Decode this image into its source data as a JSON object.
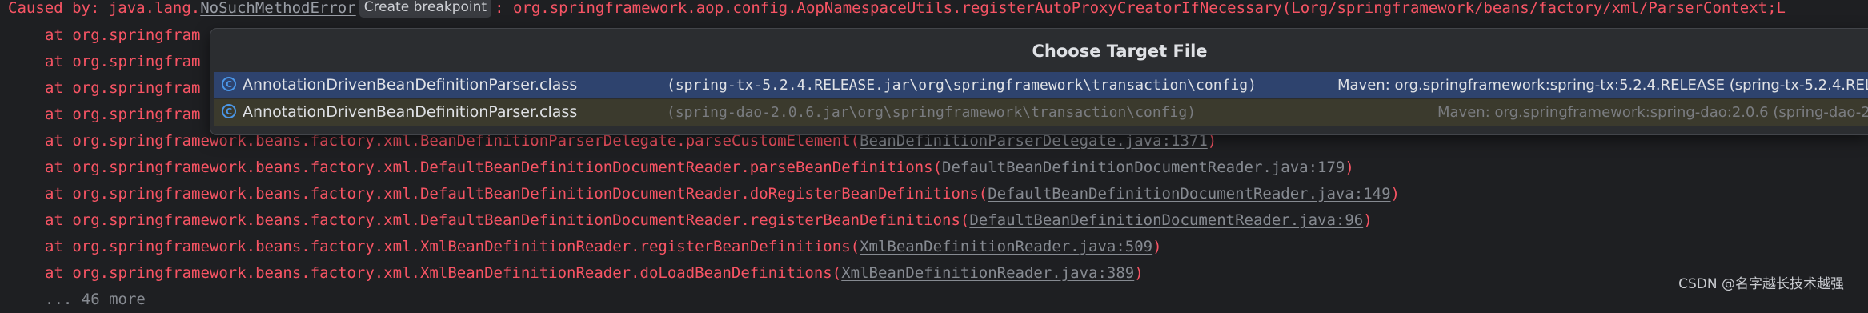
{
  "console": {
    "caused_by_prefix": "Caused by: java.lang.",
    "exception_name": "NoSuchMethodError",
    "breakpoint_button": "Create breakpoint",
    "caused_by_rest": ": org.springframework.aop.config.AopNamespaceUtils.registerAutoProxyCreatorIfNecessary(Lorg/springframework/beans/factory/xml/ParserContext;L",
    "lines": [
      {
        "prefix": "at org.springfram",
        "link": "",
        "suffix": ""
      },
      {
        "prefix": "at org.springfram",
        "link": "",
        "suffix": ""
      },
      {
        "prefix": "at org.springfram",
        "link": "",
        "suffix": ""
      },
      {
        "prefix": "at org.springfram",
        "link": "",
        "suffix": ""
      },
      {
        "prefix": "at org.springframework.beans.factory.xml.BeanDefinitionParserDelegate.parseCustomElement(",
        "link": "BeanDefinitionParserDelegate.java:1371",
        "suffix": ")"
      },
      {
        "prefix": "at org.springframework.beans.factory.xml.DefaultBeanDefinitionDocumentReader.parseBeanDefinitions(",
        "link": "DefaultBeanDefinitionDocumentReader.java:179",
        "suffix": ")"
      },
      {
        "prefix": "at org.springframework.beans.factory.xml.DefaultBeanDefinitionDocumentReader.doRegisterBeanDefinitions(",
        "link": "DefaultBeanDefinitionDocumentReader.java:149",
        "suffix": ")"
      },
      {
        "prefix": "at org.springframework.beans.factory.xml.DefaultBeanDefinitionDocumentReader.registerBeanDefinitions(",
        "link": "DefaultBeanDefinitionDocumentReader.java:96",
        "suffix": ")"
      },
      {
        "prefix": "at org.springframework.beans.factory.xml.XmlBeanDefinitionReader.registerBeanDefinitions(",
        "link": "XmlBeanDefinitionReader.java:509",
        "suffix": ")"
      },
      {
        "prefix": "at org.springframework.beans.factory.xml.XmlBeanDefinitionReader.doLoadBeanDefinitions(",
        "link": "XmlBeanDefinitionReader.java:389",
        "suffix": ")"
      }
    ],
    "last_partial": "... 46 more"
  },
  "popup": {
    "title": "Choose Target File",
    "icon_letter": "C",
    "icon": "class-icon",
    "items": [
      {
        "class_name": "AnnotationDrivenBeanDefinitionParser.class",
        "path": "(spring-tx-5.2.4.RELEASE.jar\\org\\springframework\\transaction\\config)",
        "maven": "Maven: org.springframework:spring-tx:5.2.4.RELEASE (spring-tx-5.2.4.RELE",
        "selected": true
      },
      {
        "class_name": "AnnotationDrivenBeanDefinitionParser.class",
        "path": "(spring-dao-2.0.6.jar\\org\\springframework\\transaction\\config)",
        "maven": "Maven: org.springframework:spring-dao:2.0.6 (spring-dao-2.",
        "selected": false
      }
    ]
  },
  "watermark": "CSDN @名字越长技术越强",
  "colors": {
    "background": "#1e1f22",
    "error_text": "#f75464",
    "popup_bg": "#2b2d30",
    "selected_row": "#2e436e",
    "accent_icon": "#4b97e8"
  }
}
